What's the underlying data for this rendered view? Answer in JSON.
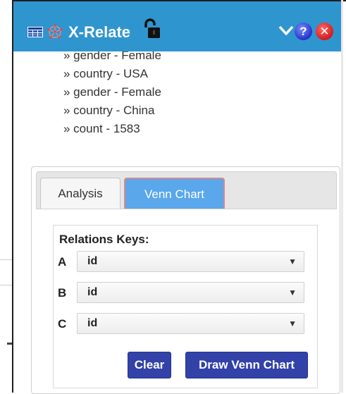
{
  "window": {
    "title": "X-Relate",
    "help_label": "?",
    "close_label": "✕"
  },
  "results": [
    "» gender - Female",
    "» country - USA",
    "» gender - Female",
    "» country - China",
    "» count - 1583"
  ],
  "tabs": {
    "analysis": "Analysis",
    "venn": "Venn Chart"
  },
  "relations": {
    "title": "Relations Keys:",
    "keys": [
      {
        "letter": "A",
        "value": "id"
      },
      {
        "letter": "B",
        "value": "id"
      },
      {
        "letter": "C",
        "value": "id"
      }
    ],
    "dropdown_arrow": "▼"
  },
  "buttons": {
    "clear": "Clear",
    "draw": "Draw Venn Chart"
  },
  "colors": {
    "titlebar": "#2f95cf",
    "active_tab": "#5aa7ec",
    "button": "#3342a8"
  },
  "icons": {
    "grid": "grid-icon",
    "network": "network-icon",
    "lock": "unlock-icon",
    "collapse": "chevron-down-icon",
    "help": "help-icon",
    "close": "close-icon"
  }
}
